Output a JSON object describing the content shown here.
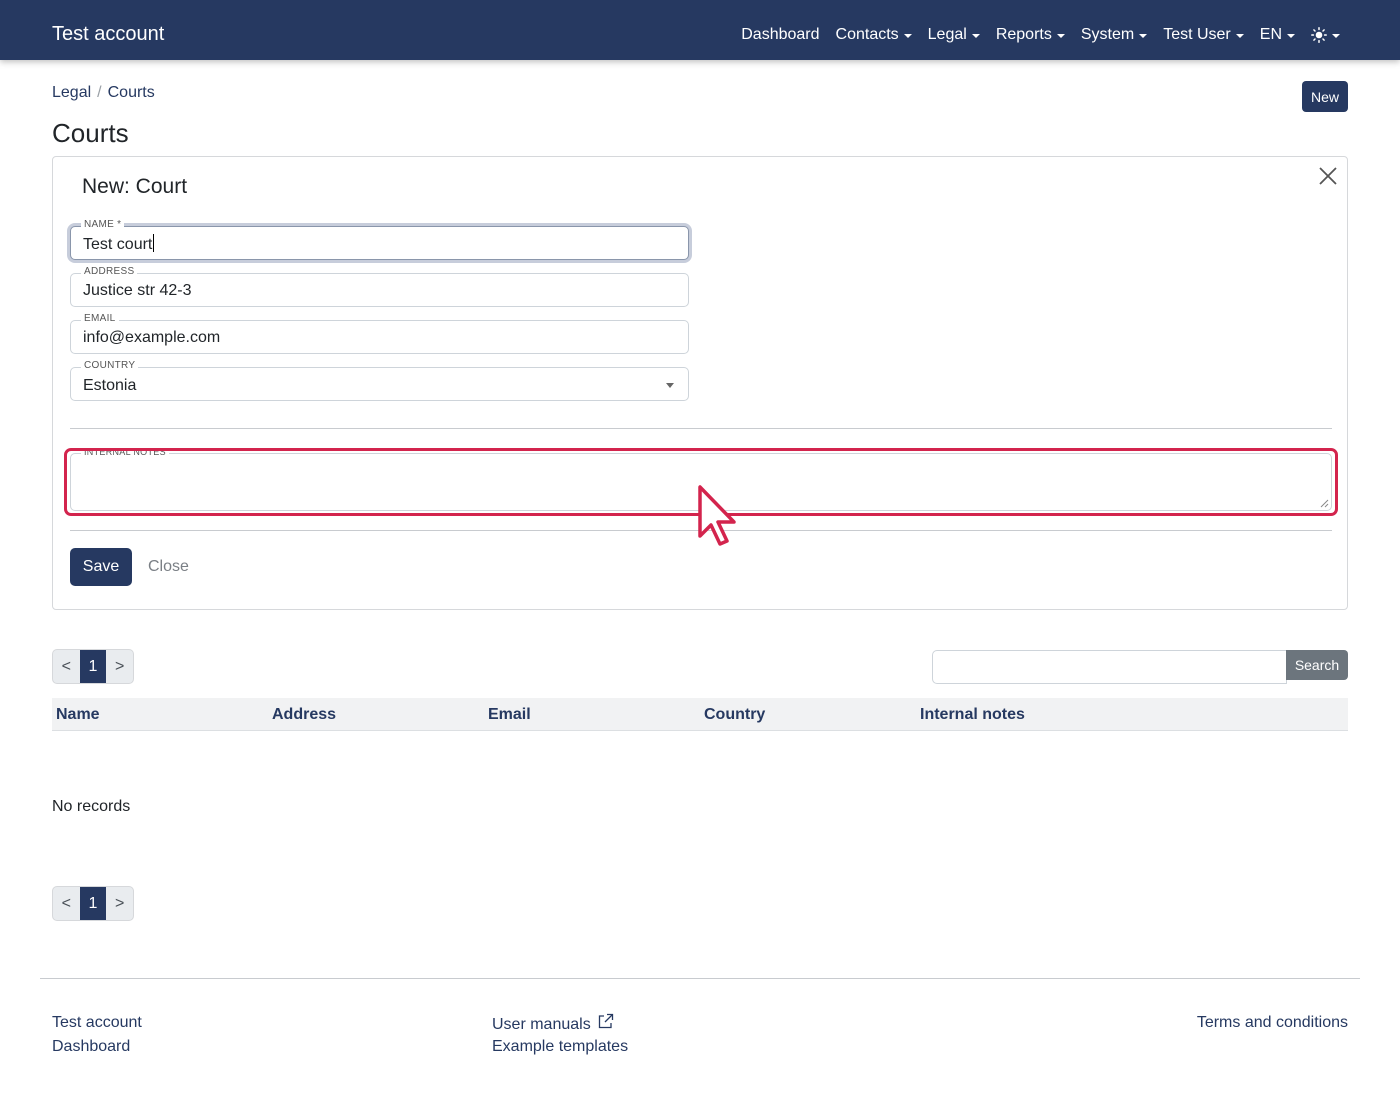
{
  "navbar": {
    "brand": "Test account",
    "items": [
      {
        "label": "Dashboard",
        "dropdown": false
      },
      {
        "label": "Contacts",
        "dropdown": true
      },
      {
        "label": "Legal",
        "dropdown": true
      },
      {
        "label": "Reports",
        "dropdown": true
      },
      {
        "label": "System",
        "dropdown": true
      },
      {
        "label": "Test User",
        "dropdown": true
      },
      {
        "label": "EN",
        "dropdown": true
      }
    ],
    "theme_icon": "sun-icon"
  },
  "breadcrumb": {
    "items": [
      "Legal",
      "Courts"
    ],
    "separator": "/"
  },
  "header": {
    "new_label": "New",
    "title": "Courts"
  },
  "form": {
    "title": "New: Court",
    "fields": {
      "name": {
        "label": "NAME *",
        "value": "Test court"
      },
      "address": {
        "label": "ADDRESS",
        "value": "Justice str 42-3"
      },
      "email": {
        "label": "EMAIL",
        "value": "info@example.com"
      },
      "country": {
        "label": "COUNTRY",
        "value": "Estonia"
      },
      "notes": {
        "label": "INTERNAL NOTES",
        "value": ""
      }
    },
    "save_label": "Save",
    "close_label": "Close"
  },
  "pagination": {
    "prev": "<",
    "current": "1",
    "next": ">"
  },
  "search": {
    "placeholder": "",
    "button_label": "Search"
  },
  "table": {
    "columns": [
      "Name",
      "Address",
      "Email",
      "Country",
      "Internal notes"
    ],
    "empty_text": "No records"
  },
  "footer": {
    "left": [
      "Test account",
      "Dashboard"
    ],
    "middle": [
      "User manuals",
      "Example templates"
    ],
    "right": [
      "Terms and conditions"
    ]
  },
  "colors": {
    "primary": "#263961",
    "highlight": "#d3244d",
    "secondary_button": "#6c757d"
  }
}
